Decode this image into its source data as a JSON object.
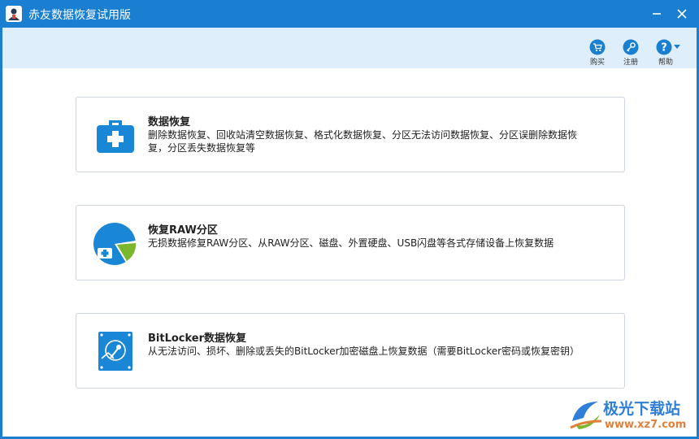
{
  "window": {
    "title": "赤友数据恢复试用版"
  },
  "toolbar": {
    "buy_label": "购买",
    "register_label": "注册",
    "help_label": "帮助"
  },
  "cards": [
    {
      "title": "数据恢复",
      "desc": "删除数据恢复、回收站清空数据恢复、格式化数据恢复、分区无法访问数据恢复、分区误删除数据恢复，分区丢失数据恢复等",
      "icon": "medical-kit-icon"
    },
    {
      "title": "恢复RAW分区",
      "desc": "无损数据修复RAW分区、从RAW分区、磁盘、外置硬盘、USB闪盘等各式存储设备上恢复数据",
      "icon": "raw-partition-icon"
    },
    {
      "title": "BitLocker数据恢复",
      "desc": "从无法访问、损坏、删除或丢失的BitLocker加密磁盘上恢复数据（需要BitLocker密码或恢复密钥）",
      "icon": "bitlocker-key-icon"
    }
  ],
  "watermark": {
    "name": "极光下载站",
    "url": "www.xz7.com"
  },
  "colors": {
    "accent": "#1a7fd0",
    "toolbar_bg": "#dfeefb",
    "icon_blue": "#1a86d6",
    "icon_green": "#7cb62c"
  }
}
